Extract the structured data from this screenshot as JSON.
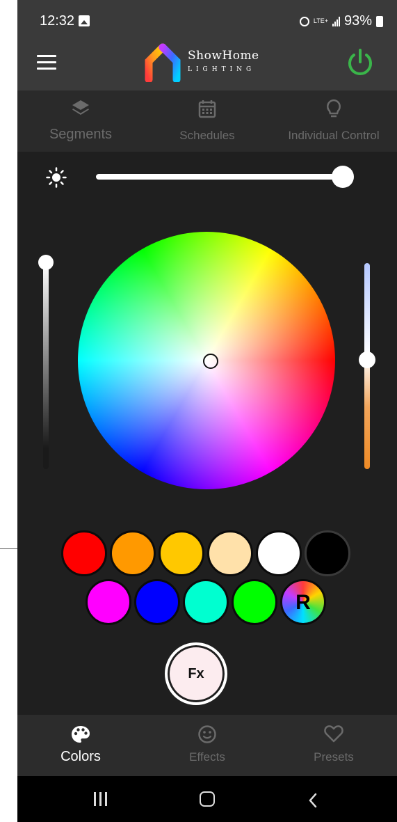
{
  "status_bar": {
    "time": "12:32",
    "network": "LTE+",
    "battery": "93%"
  },
  "app": {
    "brand_name": "ShowHome",
    "brand_sub": "LIGHTING",
    "power_color": "#3ab54a",
    "power_state": "on"
  },
  "top_tabs": [
    {
      "label": "Segments",
      "icon": "layers-icon"
    },
    {
      "label": "Schedules",
      "icon": "calendar-icon"
    },
    {
      "label": "Individual Control",
      "icon": "lightbulb-icon"
    }
  ],
  "controls": {
    "brightness_level": 1.0,
    "white_level": 1.0,
    "color_temperature_level": 0.47
  },
  "color_swatches": {
    "row1": [
      "#ff0000",
      "#ff9900",
      "#ffc800",
      "#ffe1aa",
      "#ffffff",
      "#000000"
    ],
    "row2": [
      "#ff00ff",
      "#0000ff",
      "#00ffd0",
      "#00ff00",
      "rainbow"
    ],
    "rainbow_label": "R"
  },
  "fx_button": {
    "label": "Fx"
  },
  "bottom_nav": [
    {
      "label": "Colors",
      "icon": "palette-icon",
      "active": true
    },
    {
      "label": "Effects",
      "icon": "smiley-icon",
      "active": false
    },
    {
      "label": "Presets",
      "icon": "heart-icon",
      "active": false
    }
  ]
}
